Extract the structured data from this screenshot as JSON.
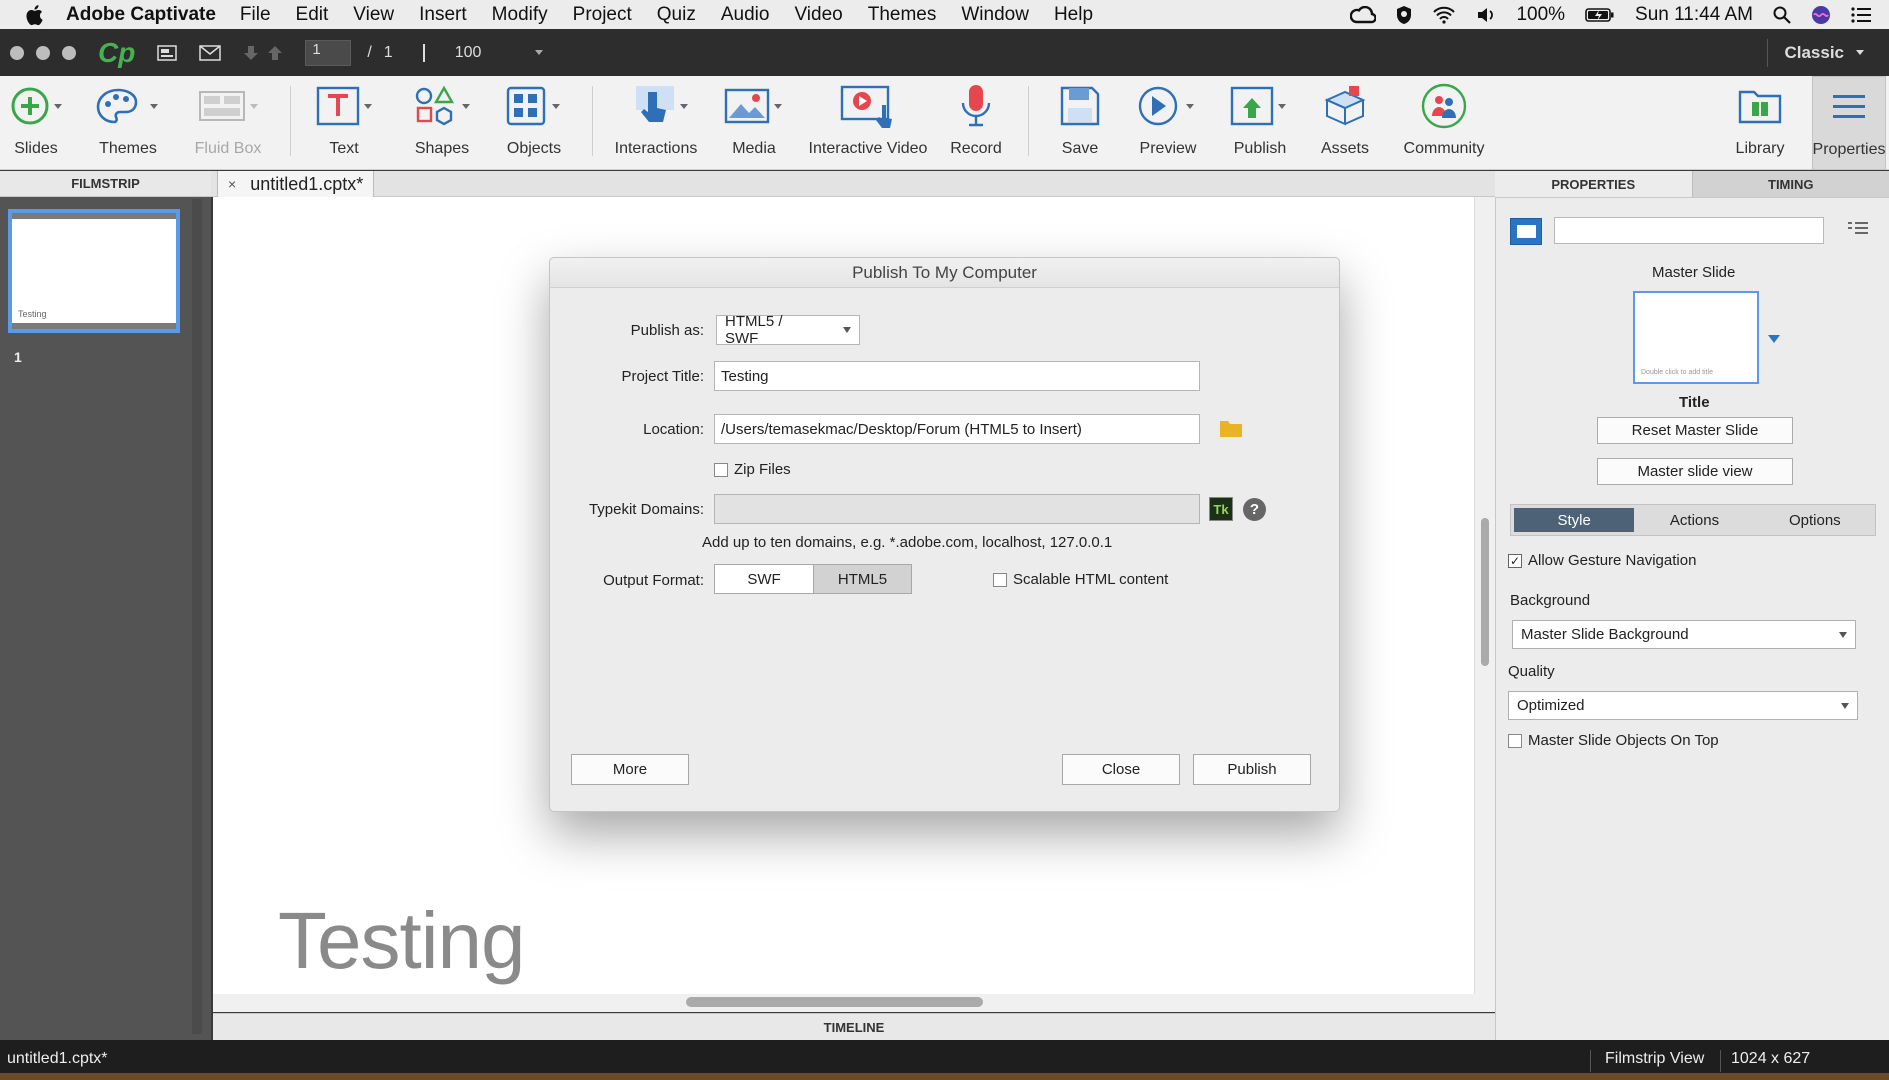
{
  "menubar": {
    "app_name": "Adobe Captivate",
    "items": [
      "File",
      "Edit",
      "View",
      "Insert",
      "Modify",
      "Project",
      "Quiz",
      "Audio",
      "Video",
      "Themes",
      "Window",
      "Help"
    ],
    "battery": "100%",
    "clock": "Sun 11:44 AM"
  },
  "toolbar": {
    "logo": "Cp",
    "current_page": "1",
    "page_sep": "/",
    "total_pages": "1",
    "zoom": "100",
    "mode": "Classic"
  },
  "ribbon": {
    "slides": "Slides",
    "themes": "Themes",
    "fluid_box": "Fluid Box",
    "text": "Text",
    "shapes": "Shapes",
    "objects": "Objects",
    "interactions": "Interactions",
    "media": "Media",
    "interactive_video": "Interactive Video",
    "record": "Record",
    "save": "Save",
    "preview": "Preview",
    "publish": "Publish",
    "assets": "Assets",
    "community": "Community",
    "library": "Library",
    "properties": "Properties"
  },
  "filmstrip": {
    "header": "FILMSTRIP",
    "thumb_title": "Testing",
    "slide_number": "1"
  },
  "document": {
    "tab_close": "×",
    "tab_label": "untitled1.cptx*",
    "slide_title": "Testing",
    "timeline": "TIMELINE"
  },
  "dialog": {
    "title": "Publish To My Computer",
    "publish_as_label": "Publish as:",
    "publish_as_value": "HTML5 / SWF",
    "project_title_label": "Project Title:",
    "project_title_value": "Testing",
    "location_label": "Location:",
    "location_value": "/Users/temasekmac/Desktop/Forum (HTML5 to Insert)",
    "zip_label": "Zip Files",
    "typekit_label": "Typekit Domains:",
    "typekit_value": "",
    "typekit_badge": "Tk",
    "help_glyph": "?",
    "typekit_hint": "Add up to ten domains, e.g. *.adobe.com, localhost, 127.0.0.1",
    "output_label": "Output Format:",
    "output_swf": "SWF",
    "output_html5": "HTML5",
    "scalable_label": "Scalable HTML content",
    "more": "More",
    "close": "Close",
    "publish": "Publish"
  },
  "properties": {
    "tab_properties": "PROPERTIES",
    "tab_timing": "TIMING",
    "name_value": "",
    "master_slide_heading": "Master Slide",
    "master_thumb_text": "Double click to add title",
    "master_name": "Title",
    "reset_button": "Reset Master Slide",
    "view_button": "Master slide view",
    "subtabs": [
      "Style",
      "Actions",
      "Options"
    ],
    "gesture_label": "Allow Gesture Navigation",
    "background_label": "Background",
    "background_value": "Master Slide Background",
    "quality_label": "Quality",
    "quality_value": "Optimized",
    "objects_on_top_label": "Master Slide Objects On Top"
  },
  "statusbar": {
    "file": "untitled1.cptx*",
    "view": "Filmstrip View",
    "dims": "1024 x 627"
  },
  "colors": {
    "accent_blue": "#2a74c4",
    "logo_green": "#44b24f",
    "record_red": "#e5474f",
    "folder_yellow": "#e8b425",
    "subtab_active": "#4d6276"
  }
}
